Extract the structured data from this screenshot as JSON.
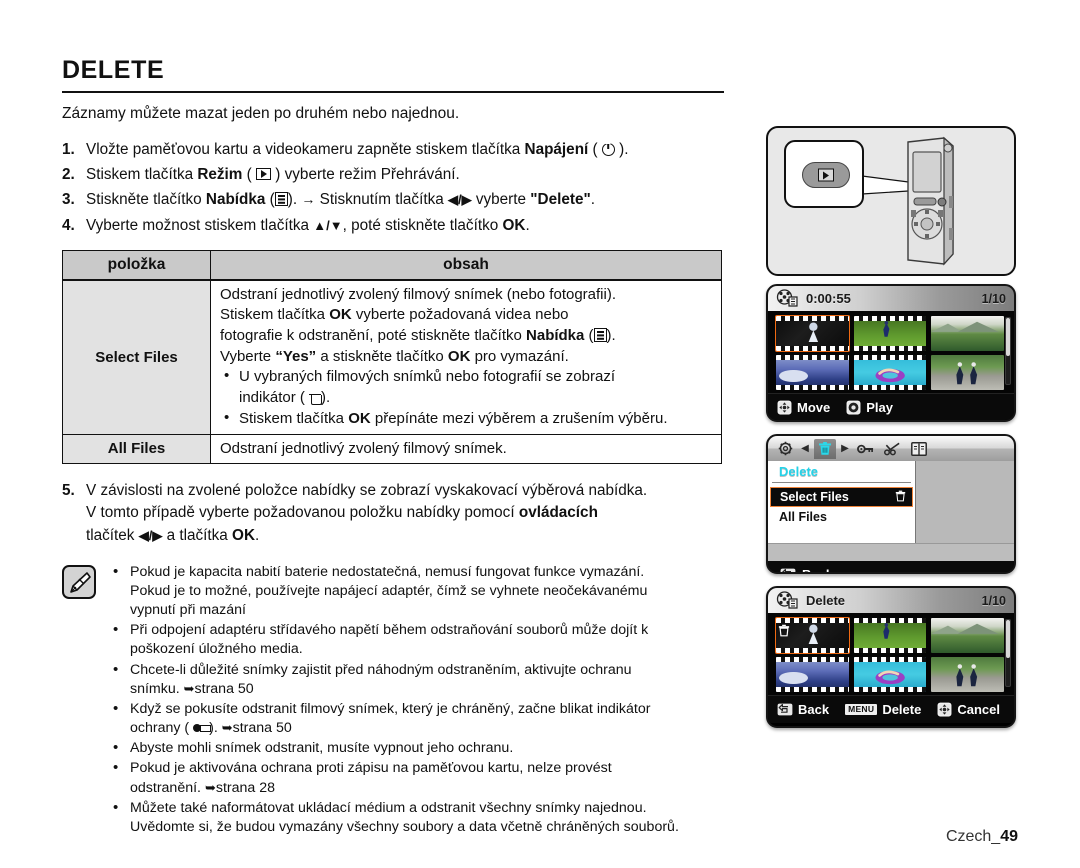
{
  "document": {
    "title": "DELETE",
    "intro": "Záznamy můžete mazat jeden po druhém nebo najednou.",
    "footer_label": "Czech_",
    "footer_page": "49"
  },
  "steps": [
    {
      "num": "1.",
      "pre": "Vložte paměťovou kartu a videokameru zapněte stiskem tlačítka ",
      "bold": "Napájení",
      "icon": "power-icon",
      "post": "."
    },
    {
      "num": "2.",
      "pre": "Stiskem tlačítka ",
      "bold": "Režim",
      "icon": "play-mode-icon",
      "post": " vyberte režim Přehrávání."
    },
    {
      "num": "3.",
      "pre": "Stiskněte tlačítko ",
      "bold": "Nabídka",
      "icon": "menu-icon",
      "mid": ". ",
      "arrow": "→",
      "mid2": " Stisknutím tlačítka ",
      "dirkeys": "◀/▶",
      "post2": " vyberte ",
      "quoted": "\"Delete\"",
      "end": "."
    },
    {
      "num": "4.",
      "pre": "Vyberte možnost stiskem tlačítka ",
      "dirkeys": "▲/▼",
      "post": ", poté stiskněte tlačítko ",
      "bold_end": "OK",
      "end": "."
    }
  ],
  "table": {
    "headers": [
      "položka",
      "obsah"
    ],
    "rows": [
      {
        "item": "Select Files",
        "lines": [
          "Odstraní jednotlivý zvolený filmový snímek (nebo fotografii).",
          "Stiskem tlačítka OK vyberte požadovaná videa nebo",
          "fotografie k odstranění, poté stiskněte tlačítko Nabídka (▤).",
          "Vyberte “Yes” a stiskněte tlačítko OK pro vymazání."
        ],
        "line1_pre": "Odstraní jednotlivý zvolený filmový snímek (nebo fotografii).",
        "line2_a": "Stiskem tlačítka ",
        "line2_b": "OK",
        "line2_c": " vyberte požadovaná videa nebo",
        "line3_a": "fotografie k odstranění, poté stiskněte tlačítko ",
        "line3_b": "Nabídka",
        "line3_c": ").",
        "line4_a": "Vyberte ",
        "line4_b": "“Yes”",
        "line4_c": " a stiskněte tlačítko ",
        "line4_d": "OK",
        "line4_e": " pro vymazání.",
        "bullets": [
          {
            "a": "U vybraných filmových snímků nebo fotografií se zobrazí",
            "b": "indikátor (",
            "c": ")."
          },
          {
            "a": "Stiskem tlačítka ",
            "b": "OK",
            "c": " přepínáte mezi výběrem a zrušením výběru."
          }
        ]
      },
      {
        "item": "All Files",
        "content": "Odstraní jednotlivý zvolený filmový snímek."
      }
    ]
  },
  "step5": {
    "num": "5.",
    "line1": "V závislosti na zvolené položce nabídky se zobrazí vyskakovací výběrová nabídka.",
    "line2_a": "V tomto případě vyberte požadovanou položku nabídky pomocí ",
    "line2_b": "ovládacích",
    "line3_a": "tlačítek ",
    "line3_keys": "◀/▶",
    "line3_b": " a tlačítka ",
    "line3_c": "OK",
    "line3_d": "."
  },
  "notes": [
    {
      "line1": "Pokud je kapacita nabití baterie nedostatečná, nemusí fungovat funkce vymazání.",
      "line2": "Pokud je to možné, používejte napájecí adaptér, čímž se vyhnete neočekávanému",
      "line3": "vypnutí při mazání"
    },
    {
      "line1": "Při odpojení adaptéru střídavého napětí během odstraňování souborů může dojít k",
      "line2": "poškození úložného media."
    },
    {
      "line1": "Chcete-li důležité snímky zajistit před náhodným odstraněním, aktivujte ochranu",
      "line2": "snímku. ",
      "ref": "strana 50"
    },
    {
      "line1": "Když se pokusíte odstranit filmový snímek, který je chráněný, začne blikat indikátor",
      "line2_a": "ochrany (",
      "line2_b": "). ",
      "ref": "strana 50"
    },
    {
      "line1": "Abyste mohli snímek odstranit, musíte vypnout jeho ochranu."
    },
    {
      "line1": "Pokud je aktivována ochrana proti zápisu na paměťovou kartu, nelze provést",
      "line2": "odstranění. ",
      "ref": "strana 28"
    },
    {
      "line1": "Můžete také naformátovat ukládací médium a odstranit všechny snímky najednou.",
      "line2": "Uvědomte si, že budou vymazány všechny soubory a data včetně chráněných souborů."
    }
  ],
  "illustrations": {
    "camera_panel": {
      "name": "camcorder-mode-button-callout"
    },
    "thumbnail_screen": {
      "time": "0:00:55",
      "counter": "1/10",
      "hints": [
        {
          "icon": "dpad-icon",
          "label": "Move"
        },
        {
          "icon": "ok-button-icon",
          "label": "Play"
        }
      ],
      "thumbnails": [
        {
          "name": "bride-video",
          "film": true,
          "selected": true
        },
        {
          "name": "soccer-video",
          "film": true,
          "selected": false
        },
        {
          "name": "mountain-photo",
          "film": false,
          "selected": false
        },
        {
          "name": "snow-video",
          "film": true,
          "selected": false
        },
        {
          "name": "pool-float-video",
          "film": true,
          "selected": false
        },
        {
          "name": "skaters-photo",
          "film": false,
          "selected": false
        }
      ]
    },
    "menu_screen": {
      "tabs": [
        {
          "name": "settings-gear-icon",
          "active": false
        },
        {
          "name": "nav-left-arrow",
          "active": false
        },
        {
          "name": "delete-trash-icon",
          "active": true
        },
        {
          "name": "nav-right-arrow",
          "active": false
        },
        {
          "name": "protect-key-icon",
          "active": false
        },
        {
          "name": "edit-scissors-icon",
          "active": false
        },
        {
          "name": "file-info-icon",
          "active": false
        }
      ],
      "heading": "Delete",
      "items": [
        {
          "label": "Select Files",
          "selected": true,
          "icon": "trash-icon"
        },
        {
          "label": "All Files",
          "selected": false,
          "icon": ""
        }
      ],
      "back_label": "Back"
    },
    "delete_screen": {
      "title": "Delete",
      "counter": "1/10",
      "hints": [
        {
          "icon": "back-arrow-icon",
          "label": "Back"
        },
        {
          "icon": "menu-chip",
          "chip": "MENU",
          "label": "Delete"
        },
        {
          "icon": "dpad-icon",
          "label": "Cancel"
        }
      ],
      "thumbnails": [
        {
          "name": "bride-video",
          "film": true,
          "selected": true,
          "marked": true
        },
        {
          "name": "soccer-video",
          "film": true,
          "selected": false,
          "marked": false
        },
        {
          "name": "mountain-photo",
          "film": false,
          "selected": false,
          "marked": false
        },
        {
          "name": "snow-video",
          "film": true,
          "selected": false,
          "marked": false
        },
        {
          "name": "pool-float-video",
          "film": true,
          "selected": false,
          "marked": false
        },
        {
          "name": "skaters-photo",
          "film": false,
          "selected": false,
          "marked": false
        }
      ]
    }
  },
  "colors": {
    "selection_orange": "#f06a12",
    "menu_heading_cyan": "#25d2e8",
    "table_header_gray": "#c9c9c9",
    "table_item_gray": "#e2e2e2"
  }
}
